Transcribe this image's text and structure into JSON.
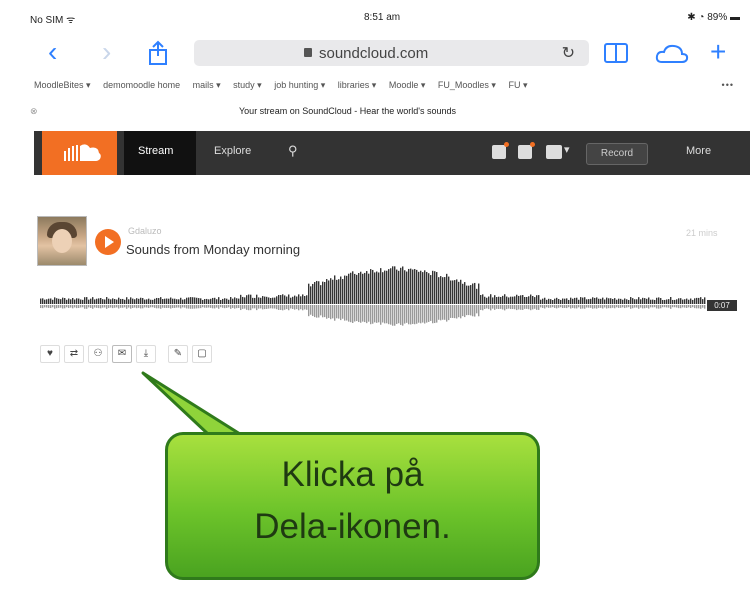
{
  "status_bar": {
    "carrier": "No SIM",
    "time": "8:51 am",
    "battery": "89%"
  },
  "browser": {
    "url": "soundcloud.com",
    "bookmarks": [
      "MoodleBites ▾",
      "demomoodle home",
      "mails ▾",
      "study ▾",
      "job hunting ▾",
      "libraries ▾",
      "Moodle ▾",
      "FU_Moodles ▾",
      "FU ▾"
    ],
    "bookmarks_more": "•••",
    "page_title": "Your stream on SoundCloud - Hear the world's sounds"
  },
  "soundcloud_header": {
    "nav": [
      "Stream",
      "Explore"
    ],
    "record_label": "Record",
    "more_label": "More"
  },
  "track": {
    "username": "Gdaluzo",
    "title": "Sounds from Monday morning",
    "time_ago": "21 mins",
    "duration": "0:07"
  },
  "actions": [
    "like-icon",
    "repost-icon",
    "follow-icon",
    "share-icon",
    "download-icon",
    "edit-icon",
    "delete-icon"
  ],
  "callout": {
    "line1": "Klicka på",
    "line2": "Dela-ikonen."
  },
  "colors": {
    "accent": "#f26f23",
    "header_bg": "#333333",
    "callout_green": "#6cc32a",
    "link_blue": "#2f80ff"
  }
}
